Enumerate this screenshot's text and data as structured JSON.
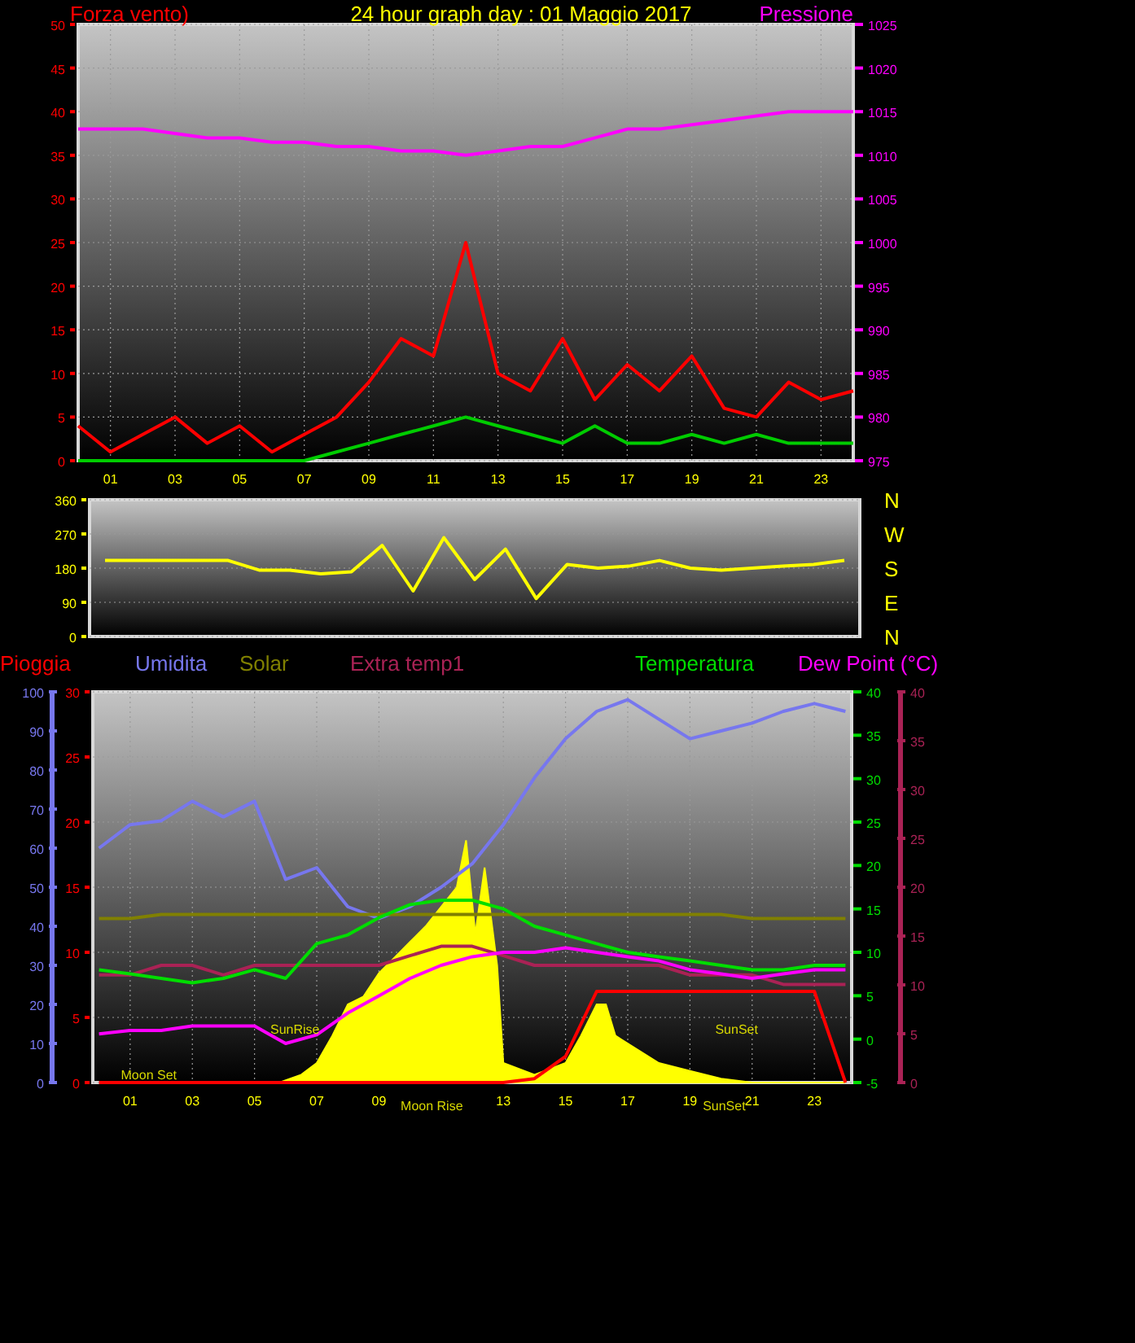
{
  "wind_pressure_panel": {
    "chart_data": {
      "type": "line",
      "grid": true,
      "title": "24 hour graph day : 01 Maggio 2017",
      "ylabel": "Forza vento)",
      "y2label": "Pressione",
      "xlim": [
        0,
        24
      ],
      "xticks": [
        {
          "value": 1,
          "label": "01"
        },
        {
          "value": 3,
          "label": "03"
        },
        {
          "value": 5,
          "label": "05"
        },
        {
          "value": 7,
          "label": "07"
        },
        {
          "value": 9,
          "label": "09"
        },
        {
          "value": 11,
          "label": "11"
        },
        {
          "value": 13,
          "label": "13"
        },
        {
          "value": 15,
          "label": "15"
        },
        {
          "value": 17,
          "label": "17"
        },
        {
          "value": 19,
          "label": "19"
        },
        {
          "value": 21,
          "label": "21"
        },
        {
          "value": 23,
          "label": "23"
        }
      ],
      "ylim": [
        0,
        50
      ],
      "yticks": [
        0,
        5,
        10,
        15,
        20,
        25,
        30,
        35,
        40,
        45,
        50
      ],
      "y2lim": [
        975,
        1025
      ],
      "y2ticks": [
        975,
        980,
        985,
        990,
        995,
        1000,
        1005,
        1010,
        1015,
        1020,
        1025
      ],
      "x": [
        0,
        1,
        2,
        3,
        4,
        5,
        6,
        7,
        8,
        9,
        10,
        11,
        12,
        13,
        14,
        15,
        16,
        17,
        18,
        19,
        20,
        21,
        22,
        23,
        24
      ],
      "series": [
        {
          "color": "#ff0000",
          "values": [
            4,
            1,
            3,
            5,
            2,
            4,
            1,
            3,
            5,
            9,
            14,
            12,
            25,
            10,
            8,
            14,
            7,
            11,
            8,
            12,
            6,
            5,
            9,
            7,
            8
          ]
        },
        {
          "color": "#00cc00",
          "values": [
            0,
            0,
            0,
            0,
            0,
            0,
            0,
            0,
            1,
            2,
            3,
            4,
            5,
            4,
            3,
            2,
            4,
            2,
            2,
            3,
            2,
            3,
            2,
            2,
            2
          ]
        },
        {
          "color": "#ff00ff",
          "axis": "y2",
          "values": [
            1013,
            1013,
            1013,
            1012.5,
            1012,
            1012,
            1011.5,
            1011.5,
            1011,
            1011,
            1010.5,
            1010.5,
            1010,
            1010.5,
            1011,
            1011,
            1012,
            1013,
            1013,
            1013.5,
            1014,
            1014.5,
            1015,
            1015,
            1015
          ]
        }
      ]
    }
  },
  "wind_direction_panel": {
    "chart_data": {
      "type": "line",
      "grid": true,
      "ylim": [
        0,
        360
      ],
      "yticks": [
        0,
        90,
        180,
        270,
        360
      ],
      "categories": [
        null,
        null,
        null,
        null,
        null,
        null,
        null,
        null,
        null,
        null,
        null,
        null,
        null,
        null,
        null,
        null,
        null,
        null,
        null,
        null,
        null,
        null,
        null,
        null,
        null
      ],
      "series": [
        {
          "color": "#ffff00",
          "values": [
            200,
            200,
            200,
            200,
            200,
            175,
            175,
            165,
            170,
            240,
            120,
            260,
            150,
            230,
            100,
            190,
            180,
            185,
            200,
            180,
            175,
            180,
            185,
            190,
            200
          ]
        }
      ]
    },
    "compass_labels": [
      "N",
      "W",
      "S",
      "E",
      "N"
    ]
  },
  "weather_panel": {
    "chart_data": {
      "type": "line",
      "grid": true,
      "xlim": [
        -0.2,
        24.2
      ],
      "xticks": [
        {
          "value": 1,
          "label": "01"
        },
        {
          "value": 3,
          "label": "03"
        },
        {
          "value": 5,
          "label": "05"
        },
        {
          "value": 7,
          "label": "07"
        },
        {
          "value": 9,
          "label": "09"
        },
        {
          "value": 13,
          "label": "13"
        },
        {
          "value": 15,
          "label": "15"
        },
        {
          "value": 17,
          "label": "17"
        },
        {
          "value": 19,
          "label": "19"
        },
        {
          "value": 21,
          "label": "21"
        },
        {
          "value": 23,
          "label": "23"
        }
      ],
      "ylim": [
        0,
        30
      ],
      "yticks": [
        0,
        5,
        10,
        15,
        20,
        25,
        30
      ],
      "y2lim": [
        0,
        100
      ],
      "y2ticks": [
        0,
        10,
        20,
        30,
        40,
        50,
        60,
        70,
        80,
        90,
        100
      ],
      "y3lim": [
        -5,
        40
      ],
      "y3ticks": [
        -5,
        0,
        5,
        10,
        15,
        20,
        25,
        30,
        35,
        40
      ],
      "x": [
        0,
        1,
        2,
        3,
        4,
        5,
        6,
        7,
        8,
        9,
        10,
        11,
        12,
        13,
        14,
        15,
        16,
        17,
        18,
        19,
        20,
        21,
        22,
        23,
        24
      ],
      "series": [
        {
          "name": "Pioggia",
          "color": "#ff0000",
          "values": [
            0,
            0,
            0,
            0,
            0,
            0,
            0,
            0,
            0,
            0,
            0,
            0,
            0,
            0,
            0.3,
            2,
            7,
            7,
            7,
            7,
            7,
            7,
            7,
            7,
            0
          ]
        },
        {
          "name": "Umidita",
          "color": "#7777ee",
          "axis": "y2",
          "values": [
            60,
            66,
            67,
            72,
            68,
            72,
            52,
            55,
            45,
            42,
            45,
            50,
            56,
            66,
            78,
            88,
            95,
            98,
            93,
            88,
            90,
            92,
            95,
            97,
            95
          ]
        },
        {
          "name": "Solar",
          "color": "#808000",
          "axis": "y2",
          "values": [
            42,
            42,
            43,
            43,
            43,
            43,
            43,
            43,
            43,
            43,
            43,
            43,
            43,
            43,
            43,
            43,
            43,
            43,
            43,
            43,
            43,
            42,
            42,
            42,
            42
          ]
        },
        {
          "name": "Extra temp1",
          "color": "#aa2255",
          "axis": "y3",
          "values": [
            7.4,
            7.4,
            8.5,
            8.5,
            7.4,
            8.5,
            8.5,
            8.5,
            8.5,
            8.5,
            9.6,
            10.7,
            10.7,
            9.6,
            8.5,
            8.5,
            8.5,
            8.5,
            8.5,
            7.4,
            7.4,
            7.4,
            6.3,
            6.3,
            6.3
          ]
        },
        {
          "name": "Temperatura",
          "color": "#00dd00",
          "axis": "y3",
          "values": [
            8,
            7.5,
            7,
            6.5,
            7,
            8,
            7,
            11,
            12,
            14,
            15.5,
            16,
            16,
            15,
            13,
            12,
            11,
            10,
            9.5,
            9,
            8.5,
            8,
            8,
            8.5,
            8.5
          ]
        },
        {
          "name": "Dew Point (°C)",
          "color": "#ff00ff",
          "axis": "y3",
          "values": [
            0.6,
            1,
            1,
            1.5,
            1.5,
            1.5,
            -0.5,
            0.5,
            3,
            5,
            7,
            8.5,
            9.5,
            10,
            10,
            10.5,
            10,
            9.5,
            9,
            8,
            7.5,
            7,
            7.5,
            8,
            8
          ]
        }
      ],
      "annotations": [
        "Moon Set",
        "SunRise",
        "SunSet",
        "Moon Rise",
        "SunSet"
      ]
    },
    "extra_temp_axis": {
      "ticks": [
        "40",
        "35",
        "30",
        "25",
        "20",
        "15",
        "10",
        "5",
        "0"
      ]
    }
  }
}
